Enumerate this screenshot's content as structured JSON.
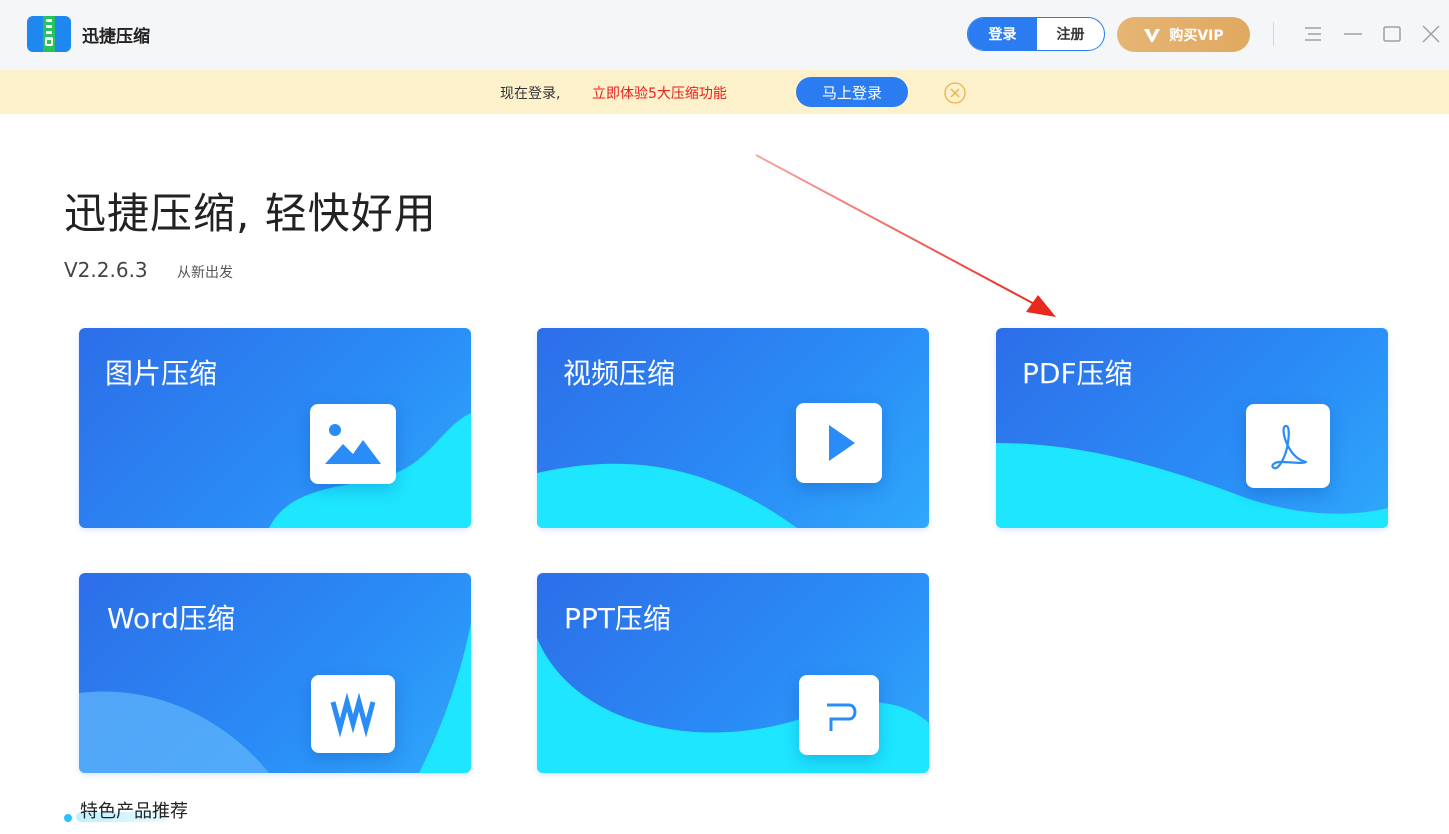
{
  "titlebar": {
    "app_title": "迅捷压缩",
    "login_label": "登录",
    "register_label": "注册",
    "vip_label": "购买VIP"
  },
  "banner": {
    "text": "现在登录,",
    "highlight": "立即体验5大压缩功能",
    "button_label": "马上登录"
  },
  "hero": {
    "title": "迅捷压缩, 轻快好用",
    "version": "V2.2.6.3",
    "version_tag": "从新出发"
  },
  "cards": [
    {
      "title": "图片压缩",
      "icon": "image-icon"
    },
    {
      "title": "视频压缩",
      "icon": "play-icon"
    },
    {
      "title": "PDF压缩",
      "icon": "pdf-icon"
    },
    {
      "title": "Word压缩",
      "icon": "word-icon"
    },
    {
      "title": "PPT压缩",
      "icon": "ppt-icon"
    }
  ],
  "featured": {
    "title": "特色产品推荐"
  },
  "colors": {
    "primary": "#2a7cf0",
    "banner_bg": "#fdf1cc",
    "highlight_red": "#e8201a",
    "vip_gold": "#e3b06a",
    "wave_cyan": "#1ee6ff",
    "arrow_red": "#e83a30"
  }
}
